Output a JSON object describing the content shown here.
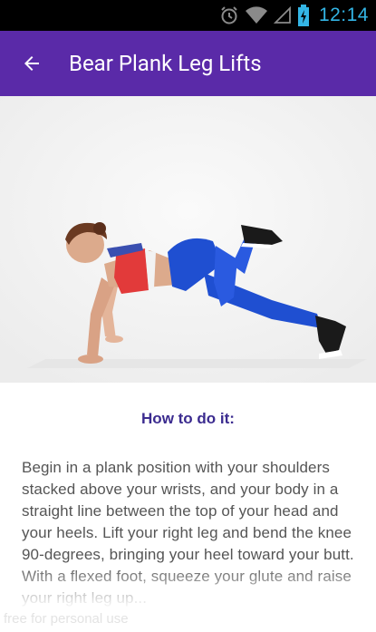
{
  "status_bar": {
    "time": "12:14",
    "icons": [
      "alarm-icon",
      "wifi-icon",
      "cell-signal-icon",
      "battery-charging-icon"
    ],
    "time_color": "#33b5e5"
  },
  "app_bar": {
    "title": "Bear Plank Leg Lifts",
    "back_icon": "arrow-back-icon",
    "background": "#5a2aa8"
  },
  "exercise_image": {
    "subject": "exercise-photo"
  },
  "how_to": {
    "heading": "How to do it:",
    "heading_color": "#3b2b8f",
    "text": "Begin in a plank position with your shoulders stacked above your wrists, and your body in a straight line between the top of your head and your heels. Lift your right leg and bend the knee 90-degrees, bringing your heel toward your butt. With a flexed foot, squeeze your glute and raise your right leg up..."
  },
  "watermark": "free for personal use"
}
